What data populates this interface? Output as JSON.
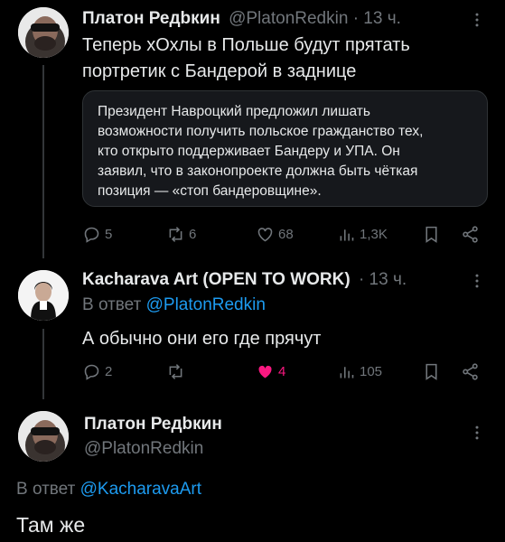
{
  "tweet1": {
    "author_name": "Платон Редbкин",
    "handle": "@PlatonRedkin",
    "time": "· 13 ч.",
    "text_line1": "Теперь хОхлы в Польше будут прятать",
    "text_line2": "портретик с Бандерой в заднице",
    "quote_lines": [
      "Президент Навроцкий предложил лишать",
      "возможности получить польское гражданство тех,",
      "кто открыто поддерживает Бандеру и УПА. Он",
      "заявил, что в законопроекте должна быть чёткая",
      "позиция — «стоп бандеровщине»."
    ],
    "actions": {
      "replies": "5",
      "reposts": "6",
      "likes": "68",
      "views": "1,3K"
    }
  },
  "tweet2": {
    "author_name": "Kacharava Art (OPEN TO WORK)",
    "time": "· 13 ч.",
    "reply_prefix": "В ответ",
    "reply_handle": "@PlatonRedkin",
    "text": "А обычно они его где прячут",
    "actions": {
      "replies": "2",
      "reposts": "",
      "likes": "4",
      "views": "105"
    },
    "liked": true
  },
  "tweet3": {
    "author_name": "Платон Редbкин",
    "handle": "@PlatonRedkin",
    "reply_prefix": "В ответ",
    "reply_handle": "@KacharavaArt",
    "text": "Там же"
  },
  "colors": {
    "background": "#000000",
    "text": "#e7e9ea",
    "muted": "#71767b",
    "link": "#1d9bf0",
    "like": "#f91880"
  },
  "icons": [
    "more-icon",
    "reply-icon",
    "repost-icon",
    "like-icon",
    "views-icon",
    "bookmark-icon",
    "share-icon"
  ]
}
